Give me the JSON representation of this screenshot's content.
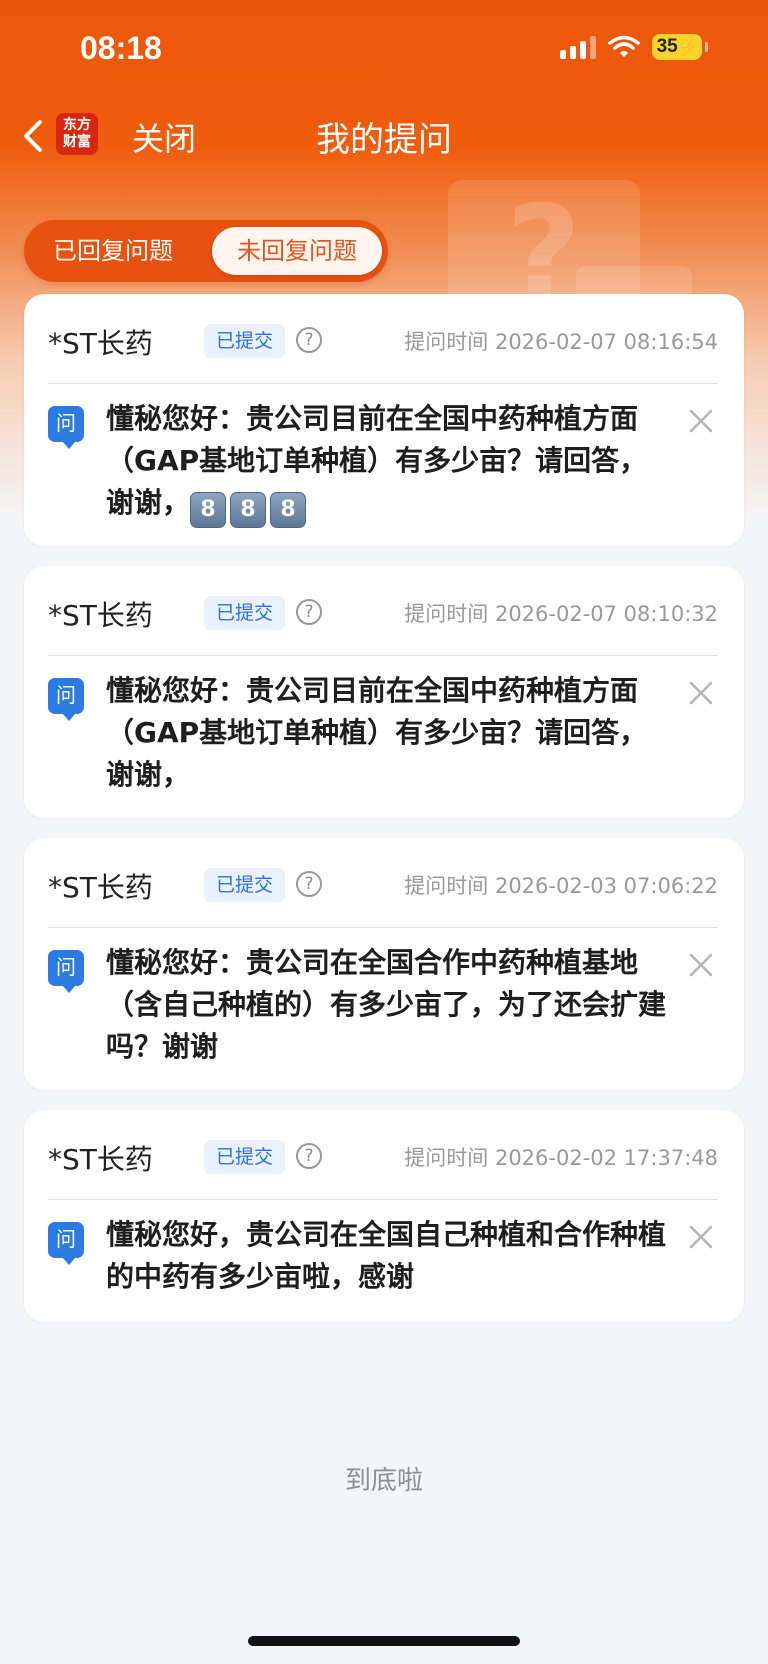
{
  "status_bar": {
    "time": "08:18",
    "battery": "35"
  },
  "nav": {
    "logo_line1": "东方",
    "logo_line2": "财富",
    "close_label": "关闭",
    "title": "我的提问"
  },
  "tabs": [
    {
      "label": "已回复问题",
      "active": false
    },
    {
      "label": "未回复问题",
      "active": true
    }
  ],
  "cards": [
    {
      "company": "*ST长药",
      "status": "已提交",
      "help": "?",
      "time": "提问时间 2026-02-07 08:16:54",
      "q_icon": "问",
      "question": "懂秘您好：贵公司目前在全国中药种植方面（GAP基地订单种植）有多少亩？请回答，谢谢，",
      "emoji_keycaps": [
        "8",
        "8",
        "8"
      ]
    },
    {
      "company": "*ST长药",
      "status": "已提交",
      "help": "?",
      "time": "提问时间 2026-02-07 08:10:32",
      "q_icon": "问",
      "question": "懂秘您好：贵公司目前在全国中药种植方面（GAP基地订单种植）有多少亩？请回答，谢谢，"
    },
    {
      "company": "*ST长药",
      "status": "已提交",
      "help": "?",
      "time": "提问时间 2026-02-03 07:06:22",
      "q_icon": "问",
      "question": "懂秘您好：贵公司在全国合作中药种植基地（含自己种植的）有多少亩了，为了还会扩建吗？谢谢"
    },
    {
      "company": "*ST长药",
      "status": "已提交",
      "help": "?",
      "time": "提问时间 2026-02-02 17:37:48",
      "q_icon": "问",
      "question": "懂秘您好，贵公司在全国自己种植和合作种植的中药有多少亩啦，感谢"
    }
  ],
  "footer": {
    "end_text": "到底啦"
  },
  "colors": {
    "brand": "#ec5609",
    "badge_bg": "#e8f1fd",
    "badge_text": "#2e72d2",
    "q_icon": "#2d7be0"
  },
  "icons": [
    "chevron-left-icon",
    "question-circle-icon",
    "close-icon",
    "signal-icon",
    "wifi-icon",
    "battery-icon"
  ]
}
